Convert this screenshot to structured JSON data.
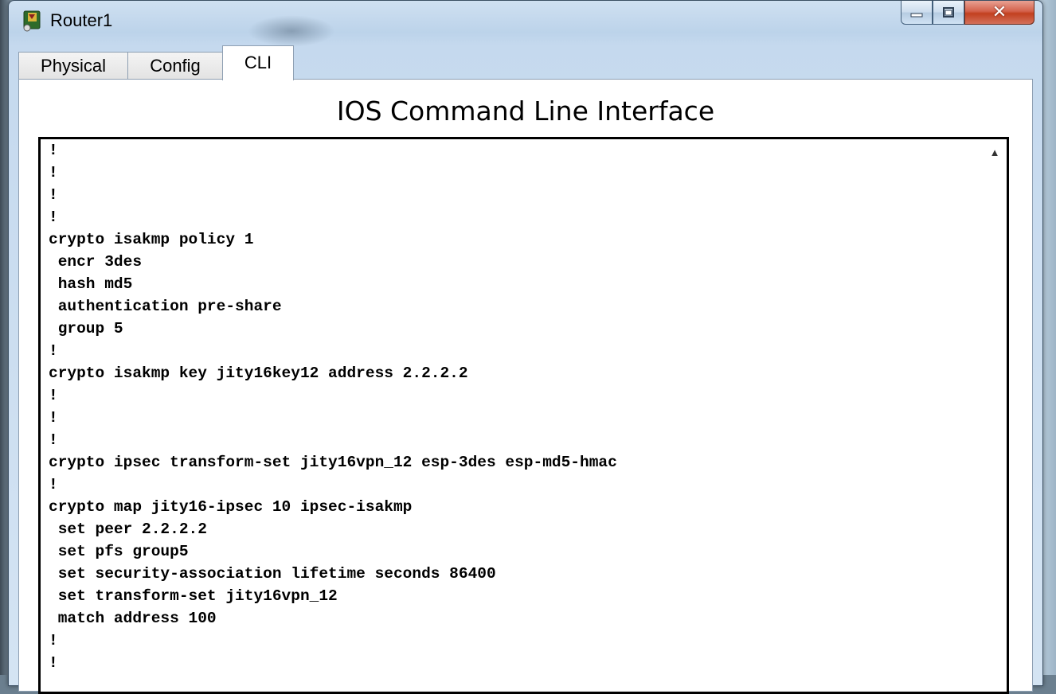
{
  "window": {
    "title": "Router1",
    "close_glyph": "✕"
  },
  "tabs": [
    {
      "label": "Physical",
      "active": false
    },
    {
      "label": "Config",
      "active": false
    },
    {
      "label": "CLI",
      "active": true
    }
  ],
  "panel": {
    "heading": "IOS Command Line Interface"
  },
  "terminal": {
    "lines": [
      "!",
      "!",
      "!",
      "!",
      "crypto isakmp policy 1",
      " encr 3des",
      " hash md5",
      " authentication pre-share",
      " group 5",
      "!",
      "crypto isakmp key jity16key12 address 2.2.2.2",
      "!",
      "!",
      "!",
      "crypto ipsec transform-set jity16vpn_12 esp-3des esp-md5-hmac",
      "!",
      "crypto map jity16-ipsec 10 ipsec-isakmp",
      " set peer 2.2.2.2",
      " set pfs group5",
      " set security-association lifetime seconds 86400",
      " set transform-set jity16vpn_12",
      " match address 100",
      "!",
      "!"
    ]
  },
  "icons": {
    "app": "router-app-icon",
    "minimize": "minimize-icon",
    "maximize": "maximize-icon",
    "close": "close-icon",
    "scroll_up": "scroll-up-arrow-icon"
  },
  "colors": {
    "close_button": "#c7462a",
    "titlebar": "#bcd3ea",
    "terminal_text": "#000000"
  }
}
